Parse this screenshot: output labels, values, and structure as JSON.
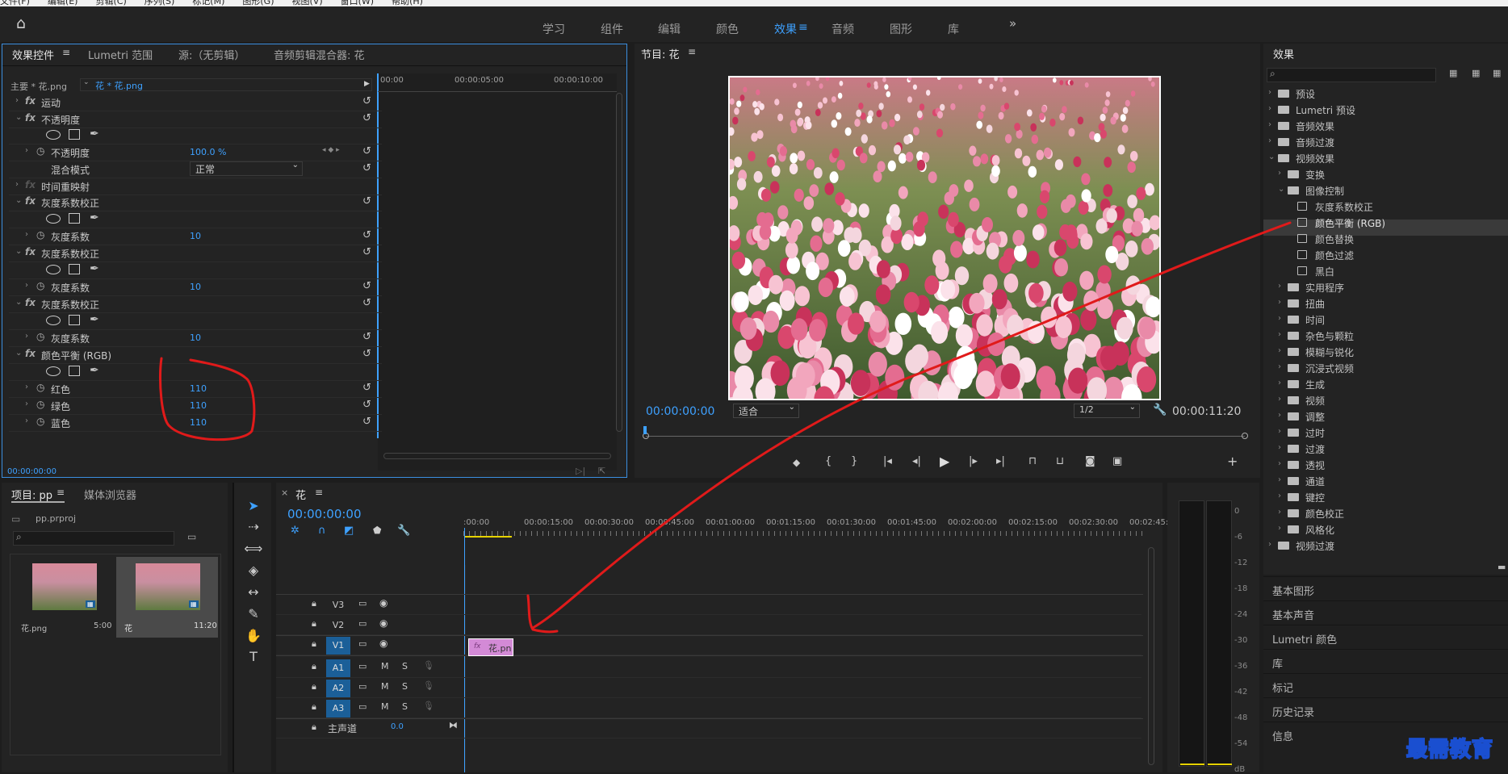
{
  "menubar": [
    "文件(F)",
    "编辑(E)",
    "剪辑(C)",
    "序列(S)",
    "标记(M)",
    "图形(G)",
    "视图(V)",
    "窗口(W)",
    "帮助(H)"
  ],
  "workspaces": [
    "学习",
    "组件",
    "编辑",
    "颜色",
    "效果",
    "音频",
    "图形",
    "库"
  ],
  "workspace_active": "效果",
  "effect_controls": {
    "tabs": [
      "效果控件",
      "Lumetri 范围",
      "源:（无剪辑）",
      "音频剪辑混合器: 花"
    ],
    "master": "主要 * 花.png",
    "clip": "花 * 花.png",
    "ruler": [
      "00:00",
      "00:00:05:00",
      "00:00:10:00"
    ],
    "rows": {
      "motion": "运动",
      "opacity": "不透明度",
      "opacity_param": "不透明度",
      "opacity_value": "100.0 %",
      "blend": "混合模式",
      "blend_value": "正常",
      "time_remap": "时间重映射",
      "gamma1": "灰度系数校正",
      "gamma1_param": "灰度系数",
      "gamma1_value": "10",
      "gamma2": "灰度系数校正",
      "gamma2_param": "灰度系数",
      "gamma2_value": "10",
      "gamma3": "灰度系数校正",
      "gamma3_param": "灰度系数",
      "gamma3_value": "10",
      "color_balance": "颜色平衡 (RGB)",
      "red": "红色",
      "red_value": "110",
      "green": "绿色",
      "green_value": "110",
      "blue": "蓝色",
      "blue_value": "110"
    },
    "timecode": "00:00:00:00"
  },
  "program": {
    "title": "节目: 花",
    "timecode": "00:00:00:00",
    "fit": "适合",
    "resolution": "1/2",
    "duration": "00:00:11:20"
  },
  "effects": {
    "title": "效果",
    "search_placeholder": "",
    "tree": [
      {
        "label": "预设",
        "level": 0,
        "kind": "folder",
        "open": false
      },
      {
        "label": "Lumetri 预设",
        "level": 0,
        "kind": "folder",
        "open": false
      },
      {
        "label": "音频效果",
        "level": 0,
        "kind": "folder",
        "open": false
      },
      {
        "label": "音频过渡",
        "level": 0,
        "kind": "folder",
        "open": false
      },
      {
        "label": "视频效果",
        "level": 0,
        "kind": "folder",
        "open": true
      },
      {
        "label": "变换",
        "level": 1,
        "kind": "folder",
        "open": false
      },
      {
        "label": "图像控制",
        "level": 1,
        "kind": "folder",
        "open": true
      },
      {
        "label": "灰度系数校正",
        "level": 2,
        "kind": "effect"
      },
      {
        "label": "颜色平衡 (RGB)",
        "level": 2,
        "kind": "effect",
        "selected": true
      },
      {
        "label": "颜色替换",
        "level": 2,
        "kind": "effect"
      },
      {
        "label": "颜色过滤",
        "level": 2,
        "kind": "effect"
      },
      {
        "label": "黑白",
        "level": 2,
        "kind": "effect"
      },
      {
        "label": "实用程序",
        "level": 1,
        "kind": "folder",
        "open": false
      },
      {
        "label": "扭曲",
        "level": 1,
        "kind": "folder",
        "open": false
      },
      {
        "label": "时间",
        "level": 1,
        "kind": "folder",
        "open": false
      },
      {
        "label": "杂色与颗粒",
        "level": 1,
        "kind": "folder",
        "open": false
      },
      {
        "label": "模糊与锐化",
        "level": 1,
        "kind": "folder",
        "open": false
      },
      {
        "label": "沉浸式视频",
        "level": 1,
        "kind": "folder",
        "open": false
      },
      {
        "label": "生成",
        "level": 1,
        "kind": "folder",
        "open": false
      },
      {
        "label": "视频",
        "level": 1,
        "kind": "folder",
        "open": false
      },
      {
        "label": "调整",
        "level": 1,
        "kind": "folder",
        "open": false
      },
      {
        "label": "过时",
        "level": 1,
        "kind": "folder",
        "open": false
      },
      {
        "label": "过渡",
        "level": 1,
        "kind": "folder",
        "open": false
      },
      {
        "label": "透视",
        "level": 1,
        "kind": "folder",
        "open": false
      },
      {
        "label": "通道",
        "level": 1,
        "kind": "folder",
        "open": false
      },
      {
        "label": "键控",
        "level": 1,
        "kind": "folder",
        "open": false
      },
      {
        "label": "颜色校正",
        "level": 1,
        "kind": "folder",
        "open": false
      },
      {
        "label": "风格化",
        "level": 1,
        "kind": "folder",
        "open": false
      },
      {
        "label": "视频过渡",
        "level": 0,
        "kind": "folder",
        "open": false
      }
    ],
    "side_panels": [
      "基本图形",
      "基本声音",
      "Lumetri 颜色",
      "库",
      "标记",
      "历史记录",
      "信息"
    ]
  },
  "project": {
    "tabs": [
      "项目: pp",
      "媒体浏览器"
    ],
    "file": "pp.prproj",
    "items": [
      {
        "name": "花.png",
        "duration": "5:00"
      },
      {
        "name": "花",
        "duration": "11:20"
      }
    ]
  },
  "timeline": {
    "tab": "花",
    "timecode": "00:00:00:00",
    "ruler": [
      ":00:00",
      "00:00:15:00",
      "00:00:30:00",
      "00:00:45:00",
      "00:01:00:00",
      "00:01:15:00",
      "00:01:30:00",
      "00:01:45:00",
      "00:02:00:00",
      "00:02:15:00",
      "00:02:30:00",
      "00:02:45:"
    ],
    "video_tracks": [
      "V3",
      "V2",
      "V1"
    ],
    "audio_tracks": [
      "A1",
      "A2",
      "A3"
    ],
    "master": "主声道",
    "master_value": "0.0",
    "clip_label": "花.pn",
    "clip_badge": "fx"
  },
  "meter": {
    "ticks": [
      "0",
      "-6",
      "-12",
      "-18",
      "-24",
      "-30",
      "-36",
      "-42",
      "-48",
      "-54",
      "dB"
    ]
  },
  "watermark": "最需教育",
  "colors": {
    "accent": "#3ea1ff",
    "annotation": "#e01a1a",
    "selected_track": "#1b5f98",
    "clip": "#d38ad6"
  }
}
